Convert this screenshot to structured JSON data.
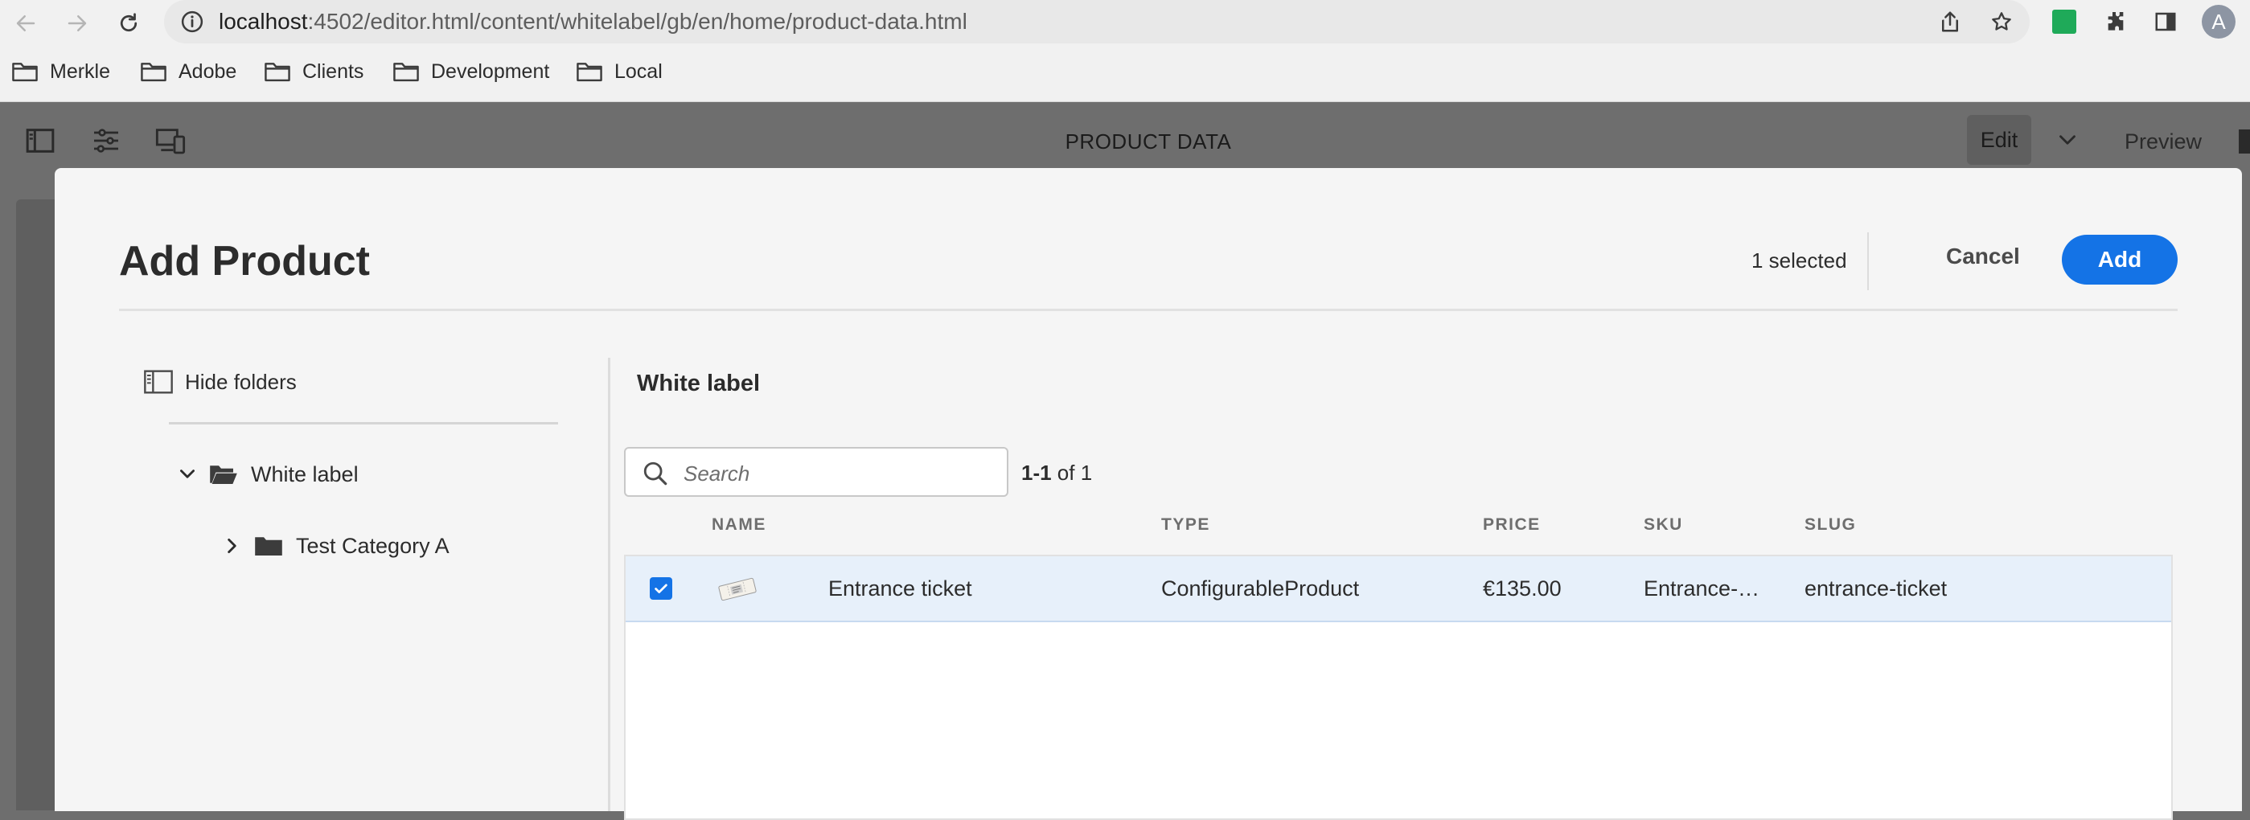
{
  "browser": {
    "url_host": "localhost",
    "url_rest": ":4502/editor.html/content/whitelabel/gb/en/home/product-data.html",
    "avatar_initial": "A",
    "bookmarks": [
      "Merkle",
      "Adobe",
      "Clients",
      "Development",
      "Local"
    ]
  },
  "editor": {
    "title": "PRODUCT DATA",
    "edit_label": "Edit",
    "preview_label": "Preview"
  },
  "dialog": {
    "title": "Add Product",
    "selected_text": "1 selected",
    "cancel_label": "Cancel",
    "add_label": "Add",
    "hide_folders_label": "Hide folders",
    "tree": [
      {
        "label": "White label",
        "expanded": true
      },
      {
        "label": "Test Category A",
        "expanded": false
      }
    ],
    "content_title": "White label",
    "search_placeholder": "Search",
    "range_bold": "1-1",
    "range_rest": " of 1",
    "columns": [
      "NAME",
      "TYPE",
      "PRICE",
      "SKU",
      "SLUG"
    ],
    "rows": [
      {
        "selected": true,
        "name": "Entrance ticket",
        "type": "ConfigurableProduct",
        "price": "€135.00",
        "sku": "Entrance-…",
        "slug": "entrance-ticket"
      }
    ]
  },
  "colors": {
    "accent": "#1473e6",
    "overlay": "#6e6e6e",
    "selected_row": "#e7f0fa",
    "extension_green": "#1faa59"
  }
}
